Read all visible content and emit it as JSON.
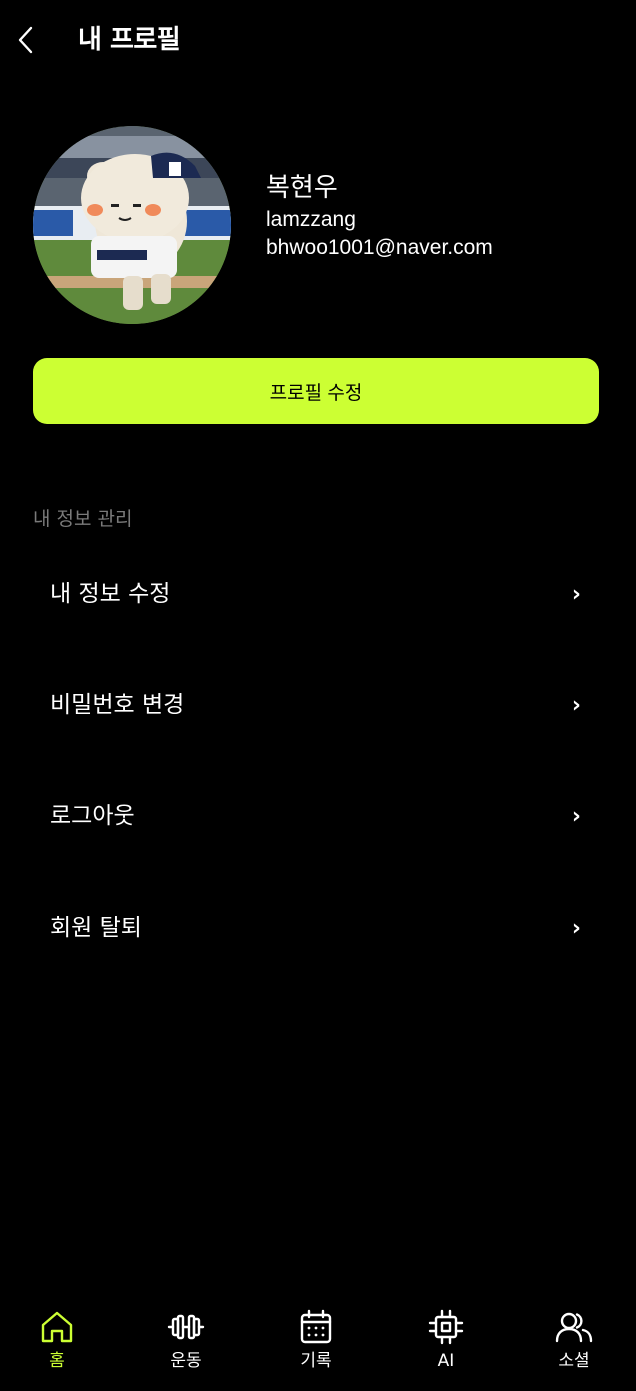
{
  "header": {
    "title": "내 프로필",
    "back_icon": "chevron-left-icon"
  },
  "profile": {
    "name": "복현우",
    "nickname": "lamzzang",
    "email": "bhwoo1001@naver.com",
    "avatar_alt": "mascot-photo"
  },
  "edit_button": {
    "label": "프로필 수정",
    "color": "#ccff33"
  },
  "section": {
    "label": "내 정보 관리"
  },
  "menu": [
    {
      "label": "내 정보 수정",
      "chevron": "›"
    },
    {
      "label": "비밀번호 변경",
      "chevron": "›"
    },
    {
      "label": "로그아웃",
      "chevron": "›"
    },
    {
      "label": "회원 탈퇴",
      "chevron": "›"
    }
  ],
  "tabs": [
    {
      "label": "홈",
      "icon": "home-icon",
      "active": true
    },
    {
      "label": "운동",
      "icon": "dumbbell-icon",
      "active": false
    },
    {
      "label": "기록",
      "icon": "calendar-icon",
      "active": false
    },
    {
      "label": "AI",
      "icon": "chip-icon",
      "active": false
    },
    {
      "label": "소셜",
      "icon": "users-icon",
      "active": false
    }
  ],
  "colors": {
    "accent": "#ccff33",
    "background": "#000000",
    "muted": "#7a7a7a"
  }
}
